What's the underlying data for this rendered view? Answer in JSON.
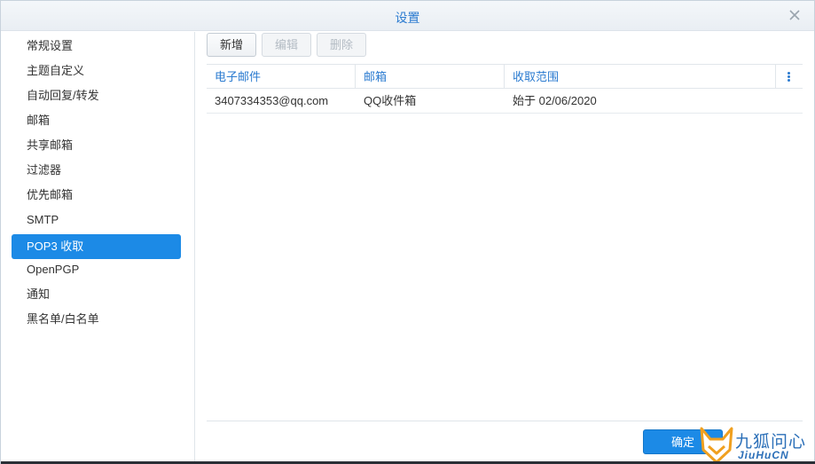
{
  "window": {
    "title": "设置"
  },
  "sidebar": {
    "items": [
      {
        "label": "常规设置"
      },
      {
        "label": "主题自定义"
      },
      {
        "label": "自动回复/转发"
      },
      {
        "label": "邮箱"
      },
      {
        "label": "共享邮箱"
      },
      {
        "label": "过滤器"
      },
      {
        "label": "优先邮箱"
      },
      {
        "label": "SMTP"
      },
      {
        "label": "POP3 收取",
        "active": true
      },
      {
        "label": "OpenPGP"
      },
      {
        "label": "通知"
      },
      {
        "label": "黑名单/白名单"
      }
    ]
  },
  "toolbar": {
    "add_label": "新增",
    "edit_label": "编辑",
    "delete_label": "删除"
  },
  "grid": {
    "columns": [
      "电子邮件",
      "邮箱",
      "收取范围"
    ],
    "rows": [
      [
        "3407334353@qq.com",
        "QQ收件箱",
        "始于 02/06/2020"
      ]
    ]
  },
  "footer": {
    "ok_label": "确定"
  },
  "watermark": {
    "text": "九狐问心",
    "subtext": "JiuHuCN"
  },
  "colors": {
    "accent": "#1c8ae6",
    "title": "#2b7bd0"
  }
}
